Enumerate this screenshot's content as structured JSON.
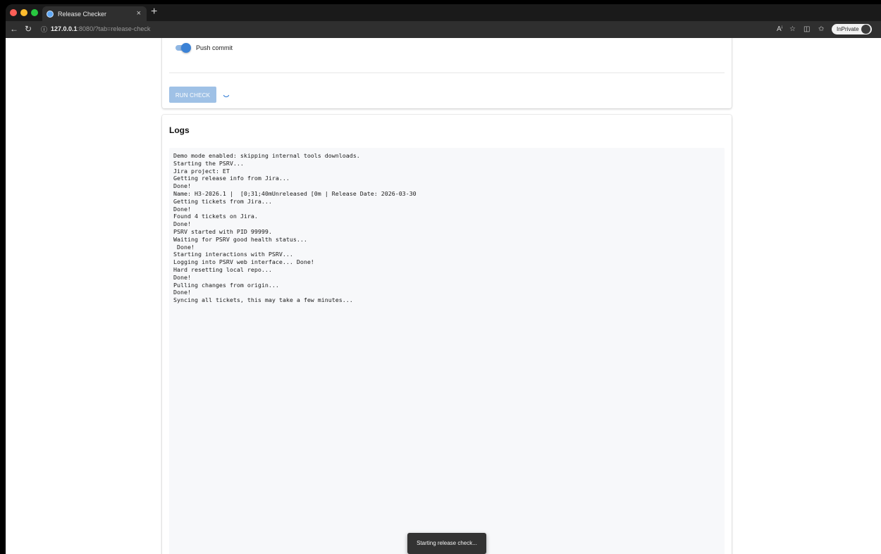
{
  "browser": {
    "tab_title": "Release Checker",
    "tab_close": "×",
    "new_tab": "+",
    "url_host": "127.0.0.1",
    "url_rest": ":8080/?tab=release-check",
    "inprivate_label": "InPrivate",
    "icons": [
      "back-icon",
      "refresh-icon",
      "info-icon",
      "read-aloud-icon",
      "favorite-icon",
      "split-screen-icon",
      "favorites-icon"
    ]
  },
  "settings": {
    "push_commit_label": "Push commit",
    "push_commit_enabled": true,
    "run_button_label": "RUN CHECK",
    "running": true
  },
  "logs": {
    "title": "Logs",
    "lines": [
      "Demo mode enabled: skipping internal tools downloads.",
      "Starting the PSRV...",
      "Jira project: ET",
      "Getting release info from Jira...",
      "Done!",
      "Name: H3-2026.1 |  [0;31;40mUnreleased [0m | Release Date: 2026-03-30",
      "Getting tickets from Jira...",
      "Done!",
      "Found 4 tickets on Jira.",
      "Done!",
      "PSRV started with PID 99999.",
      "Waiting for PSRV good health status...",
      " Done!",
      "Starting interactions with PSRV...",
      "Logging into PSRV web interface... Done!",
      "Hard resetting local repo...",
      "Done!",
      "Pulling changes from origin...",
      "Done!",
      "Syncing all tickets, this may take a few minutes..."
    ]
  },
  "snackbar": {
    "message": "Starting release check..."
  },
  "colors": {
    "accent": "#3b82d6",
    "button_disabled": "#9fc1e6",
    "log_background": "#f7f8fa",
    "snackbar": "#333333"
  }
}
